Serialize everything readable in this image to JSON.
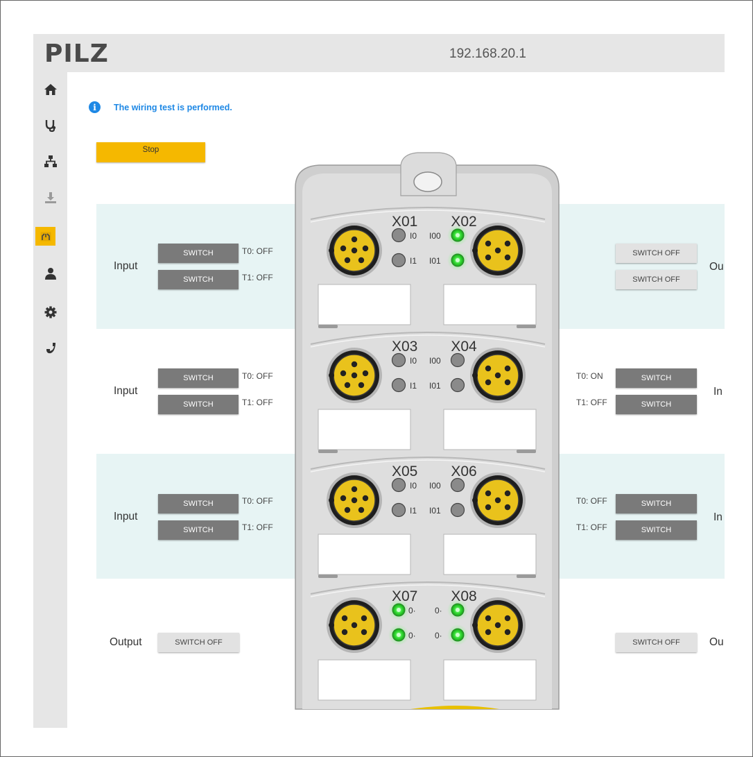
{
  "header": {
    "logo": "PILZ",
    "ip": "192.168.20.1"
  },
  "sidebar": {
    "items": [
      {
        "name": "home",
        "icon": "home-icon"
      },
      {
        "name": "diagnostics",
        "icon": "stethoscope-icon"
      },
      {
        "name": "network",
        "icon": "network-icon"
      },
      {
        "name": "download",
        "icon": "download-icon"
      },
      {
        "name": "wiring-test",
        "icon": "wiring-test-icon",
        "active": true
      },
      {
        "name": "user",
        "icon": "user-icon"
      },
      {
        "name": "settings",
        "icon": "gear-icon"
      },
      {
        "name": "contact",
        "icon": "phone-icon"
      }
    ]
  },
  "notice": {
    "text": "The wiring test is performed."
  },
  "stop_label": "Stop",
  "ports": {
    "x01": {
      "label": "Input",
      "btn0": "SWITCH",
      "btn1": "SWITCH",
      "state0": "T0: OFF",
      "state1": "T1: OFF"
    },
    "x02": {
      "label": "Ou",
      "btn0": "SWITCH OFF",
      "btn1": "SWITCH OFF"
    },
    "x03": {
      "label": "Input",
      "btn0": "SWITCH",
      "btn1": "SWITCH",
      "state0": "T0: OFF",
      "state1": "T1: OFF"
    },
    "x04": {
      "label": "In",
      "btn0": "SWITCH",
      "btn1": "SWITCH",
      "state0": "T0: ON",
      "state1": "T1: OFF"
    },
    "x05": {
      "label": "Input",
      "btn0": "SWITCH",
      "btn1": "SWITCH",
      "state0": "T0: OFF",
      "state1": "T1: OFF"
    },
    "x06": {
      "label": "In",
      "btn0": "SWITCH",
      "btn1": "SWITCH",
      "state0": "T0: OFF",
      "state1": "T1: OFF"
    },
    "x07": {
      "label": "Output",
      "btn0": "SWITCH OFF"
    },
    "x08": {
      "label": "Ou",
      "btn0": "SWITCH OFF"
    }
  },
  "device": {
    "connectors": [
      "X01",
      "X02",
      "X03",
      "X04",
      "X05",
      "X06",
      "X07",
      "X08"
    ],
    "led_labels": {
      "i0": "I0",
      "i1": "I1",
      "io0": "I00",
      "io1": "I01",
      "o_plus": "0·",
      "o_minus": "0·"
    },
    "leds": {
      "x01": [
        "off",
        "off"
      ],
      "x02": [
        "on",
        "on"
      ],
      "x03": [
        "off",
        "off"
      ],
      "x04": [
        "off",
        "off"
      ],
      "x05": [
        "off",
        "off"
      ],
      "x06": [
        "off",
        "off"
      ],
      "x07": [
        "on",
        "on"
      ],
      "x08": [
        "on",
        "on"
      ]
    }
  },
  "colors": {
    "accent": "#f5b800",
    "info": "#1e88e5",
    "led_on": "#33dd33",
    "led_off": "#8a8a8a",
    "band": "#e7f4f4"
  }
}
